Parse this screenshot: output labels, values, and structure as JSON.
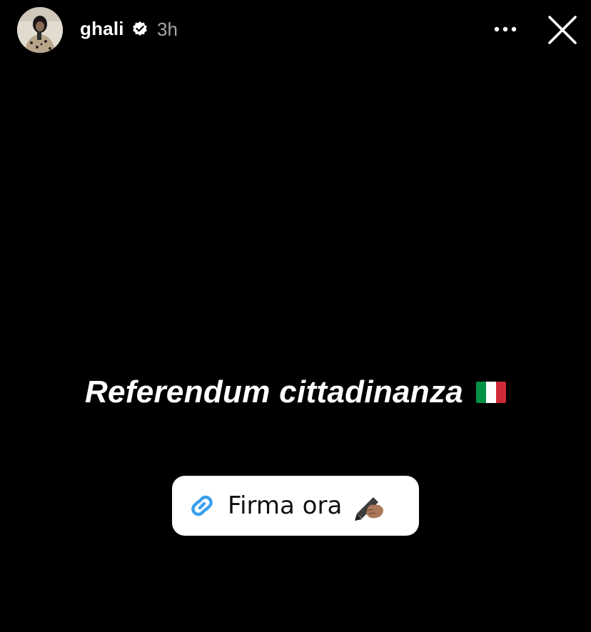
{
  "header": {
    "username": "ghali",
    "time": "3h",
    "verified_icon": "verified-badge-icon",
    "more_icon": "more-dots-icon",
    "close_icon": "close-icon"
  },
  "story": {
    "title": "Referendum cittadinanza",
    "flag_icon": "italy-flag-icon"
  },
  "link_sticker": {
    "label": "Firma ora",
    "link_icon": "link-chain-icon",
    "pen_icon": "writing-hand-icon"
  },
  "colors": {
    "background": "#000000",
    "link_blue": "#3aa0f0",
    "time_gray": "#a7a7a7"
  }
}
